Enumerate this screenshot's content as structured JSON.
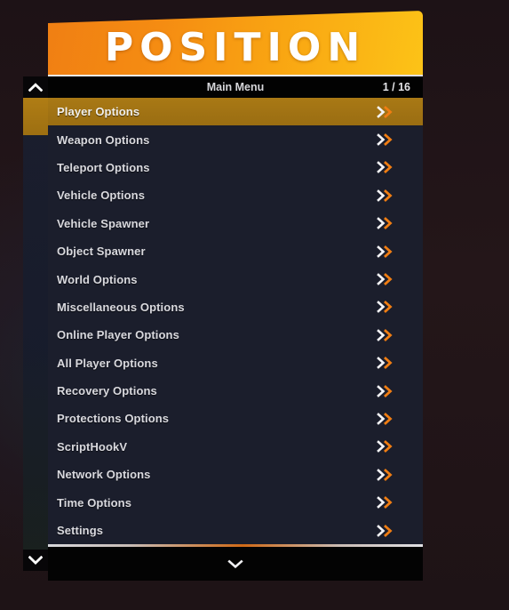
{
  "banner": {
    "title": "POSITION",
    "accent_start": "#f07f13",
    "accent_end": "#fcc317"
  },
  "header": {
    "title": "Main Menu",
    "page_counter": "1 / 16"
  },
  "scrollbar": {
    "up_icon": "chevron-up-icon",
    "down_icon": "chevron-down-icon"
  },
  "menu": {
    "selected_index": 0,
    "selected_color": "#9c7118",
    "row_color": "#1b1e2c",
    "submenu_icon": "double-chevron-right-icon",
    "items": [
      {
        "label": "Player Options"
      },
      {
        "label": "Weapon Options"
      },
      {
        "label": "Teleport Options"
      },
      {
        "label": "Vehicle Options"
      },
      {
        "label": "Vehicle Spawner"
      },
      {
        "label": "Object Spawner"
      },
      {
        "label": "World Options"
      },
      {
        "label": "Miscellaneous Options"
      },
      {
        "label": "Online Player Options"
      },
      {
        "label": "All Player Options"
      },
      {
        "label": "Recovery Options"
      },
      {
        "label": "Protections Options"
      },
      {
        "label": "ScriptHookV"
      },
      {
        "label": "Network Options"
      },
      {
        "label": "Time Options"
      },
      {
        "label": "Settings"
      }
    ]
  },
  "footer": {
    "more_icon": "chevron-down-icon"
  }
}
